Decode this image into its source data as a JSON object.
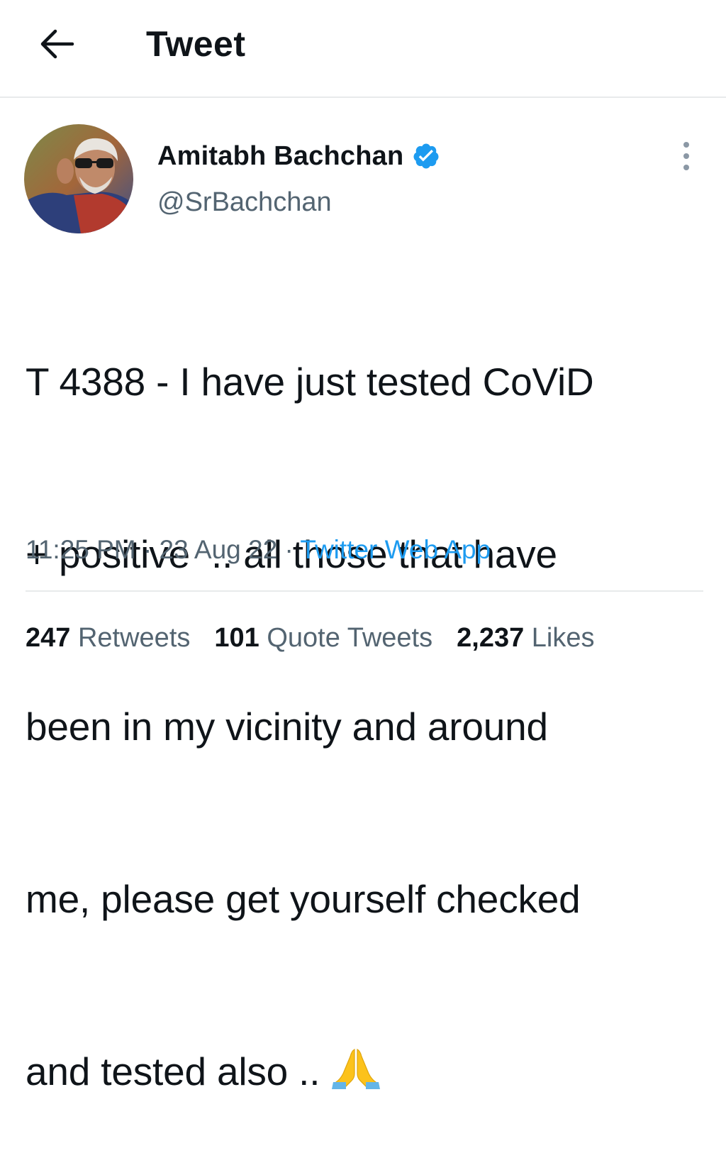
{
  "header": {
    "title": "Tweet",
    "back_icon": "arrow-left-icon"
  },
  "author": {
    "name": "Amitabh Bachchan",
    "handle": "@SrBachchan",
    "verified": true,
    "verified_icon": "verified-badge-icon",
    "verified_color": "#1d9bf0"
  },
  "tweet": {
    "lines": [
      "T 4388 - I have just tested CoViD",
      "+ positive  .. all those that have",
      "been in my vicinity and around",
      "me, please get yourself checked",
      "and tested also .. "
    ],
    "emoji": "folded-hands-emoji"
  },
  "meta": {
    "time": "11:25 PM",
    "separator": " · ",
    "date": "23 Aug 22",
    "source": "Twitter Web App"
  },
  "stats": {
    "retweets_count": "247",
    "retweets_label": "Retweets",
    "quotes_count": "101",
    "quotes_label": "Quote Tweets",
    "likes_count": "2,237",
    "likes_label": "Likes"
  },
  "colors": {
    "text": "#0f1419",
    "secondary": "#536471",
    "accent": "#1d9bf0",
    "divider": "#e8eaeb"
  }
}
